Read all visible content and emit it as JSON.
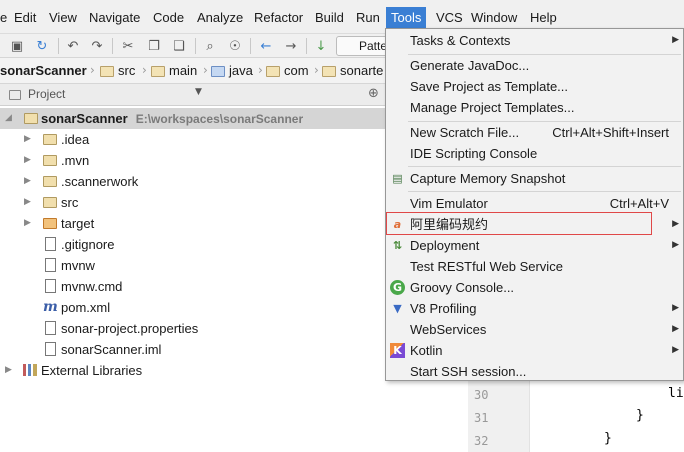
{
  "menubar": {
    "items": [
      "File",
      "Edit",
      "View",
      "Navigate",
      "Code",
      "Analyze",
      "Refactor",
      "Build",
      "Run",
      "Tools",
      "VCS",
      "Window",
      "Help"
    ],
    "first_visible": "e",
    "active": "Tools"
  },
  "toolbar": {
    "combo_text": "Patte",
    "icons": [
      "save-icon",
      "sync-icon",
      "undo-icon",
      "redo-icon",
      "cut-icon",
      "copy-icon",
      "paste-icon",
      "find-icon",
      "replace-icon",
      "back-icon",
      "forward-icon",
      "build-icon"
    ]
  },
  "breadcrumb": [
    "sonarScanner",
    "src",
    "main",
    "java",
    "com",
    "sonarte"
  ],
  "project_panel": {
    "title": "Project",
    "root": {
      "name": "sonarScanner",
      "path": "E:\\workspaces\\sonarScanner"
    },
    "children": [
      ".idea",
      ".mvn",
      ".scannerwork",
      "src",
      "target",
      ".gitignore",
      "mvnw",
      "mvnw.cmd",
      "pom.xml",
      "sonar-project.properties",
      "sonarScanner.iml"
    ],
    "external": "External Libraries"
  },
  "editor": {
    "line_numbers": [
      "30",
      "31",
      "32"
    ],
    "code": [
      "li",
      "}",
      "}"
    ]
  },
  "tools_menu": {
    "items": [
      {
        "label": "Tasks & Contexts",
        "shortcut": "",
        "submenu": true,
        "icon": ""
      },
      {
        "label": "Generate JavaDoc...",
        "shortcut": "",
        "submenu": false,
        "icon": ""
      },
      {
        "label": "Save Project as Template...",
        "shortcut": "",
        "submenu": false,
        "icon": ""
      },
      {
        "label": "Manage Project Templates...",
        "shortcut": "",
        "submenu": false,
        "icon": ""
      },
      {
        "label": "New Scratch File...",
        "shortcut": "Ctrl+Alt+Shift+Insert",
        "submenu": false,
        "icon": ""
      },
      {
        "label": "IDE Scripting Console",
        "shortcut": "",
        "submenu": false,
        "icon": ""
      },
      {
        "label": "Capture Memory Snapshot",
        "shortcut": "",
        "submenu": false,
        "icon": "memory-snapshot-icon"
      },
      {
        "label": "Vim Emulator",
        "shortcut": "Ctrl+Alt+V",
        "submenu": false,
        "icon": ""
      },
      {
        "label": "阿里编码规约",
        "shortcut": "",
        "submenu": true,
        "icon": "alibaba-icon"
      },
      {
        "label": "Deployment",
        "shortcut": "",
        "submenu": true,
        "icon": "deployment-icon"
      },
      {
        "label": "Test RESTful Web Service",
        "shortcut": "",
        "submenu": false,
        "icon": ""
      },
      {
        "label": "Groovy Console...",
        "shortcut": "",
        "submenu": false,
        "icon": "groovy-icon"
      },
      {
        "label": "V8 Profiling",
        "shortcut": "",
        "submenu": true,
        "icon": "v8-icon"
      },
      {
        "label": "WebServices",
        "shortcut": "",
        "submenu": true,
        "icon": ""
      },
      {
        "label": "Kotlin",
        "shortcut": "",
        "submenu": true,
        "icon": "kotlin-icon"
      },
      {
        "label": "Start SSH session...",
        "shortcut": "",
        "submenu": false,
        "icon": ""
      }
    ]
  },
  "colors": {
    "menu_active_bg": "#3a7fd4",
    "highlight_box": "#e04848",
    "selected_row": "#d5d5d5"
  }
}
